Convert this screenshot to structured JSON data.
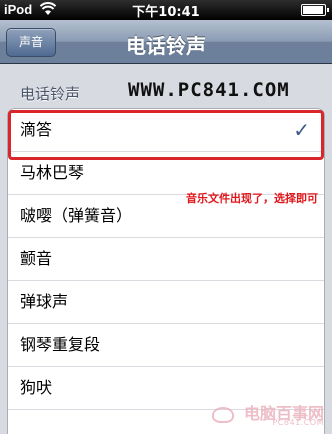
{
  "status_bar": {
    "carrier": "iPod",
    "time": "下午10:41",
    "battery_level": 0.88
  },
  "nav_bar": {
    "back_label": "声音",
    "title": "电话铃声"
  },
  "section": {
    "header": "电话铃声"
  },
  "watermark": {
    "top_text": "WWW.PC841.COM",
    "bottom_text": "电脑百事网",
    "bottom_sub": "PC841.COM"
  },
  "annotation": "音乐文件出现了，选择即可",
  "ringtones": [
    {
      "label": "滴答",
      "selected": true
    },
    {
      "label": "马林巴琴",
      "selected": false
    },
    {
      "label": "啵嘤（弹簧音）",
      "selected": false
    },
    {
      "label": "颤音",
      "selected": false
    },
    {
      "label": "弹球声",
      "selected": false
    },
    {
      "label": "钢琴重复段",
      "selected": false
    },
    {
      "label": "狗吠",
      "selected": false
    }
  ],
  "check_mark": "✓",
  "colors": {
    "nav_bar": "#8a9bb3",
    "check": "#3f5a87",
    "highlight": "#d9262b",
    "annotation": "#e0161b"
  }
}
